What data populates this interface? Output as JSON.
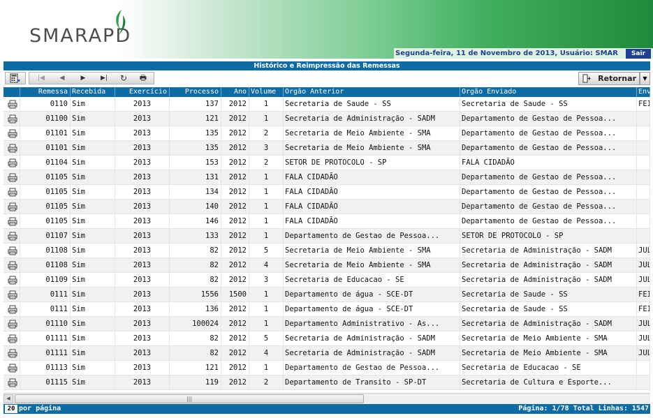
{
  "header": {
    "logo_text": "SMARAPD",
    "date_user": "Segunda-feira, 11 de Novembro de 2013, Usuário: SMAR",
    "logout_label": "Sair"
  },
  "title": "Histórico e Reimpressão das Remessas",
  "toolbar": {
    "nav": [
      "|◀",
      "◀",
      "▶",
      "▶|",
      "↻",
      "🖶"
    ],
    "return_label": "Retornar"
  },
  "columns": [
    "Remessa",
    "Recebida",
    "Exercício",
    "Processo",
    "Ano",
    "Volume",
    "Orgão Anterior",
    "Orgão Enviado",
    "Env"
  ],
  "rows": [
    [
      "0110",
      "Sim",
      "2013",
      "137",
      "2012",
      "1",
      "Secretaria de Saude - SS",
      "Secretaria de Saude - SS",
      "FEI"
    ],
    [
      "01100",
      "Sim",
      "2013",
      "121",
      "2012",
      "1",
      "Secretaria de Administração - SADM",
      "Departamento de Gestao de Pessoa...",
      ""
    ],
    [
      "01101",
      "Sim",
      "2013",
      "135",
      "2012",
      "2",
      "Secretaria de Meio Ambiente - SMA",
      "Departamento de Gestao de Pessoa...",
      ""
    ],
    [
      "01101",
      "Sim",
      "2013",
      "135",
      "2012",
      "3",
      "Secretaria de Meio Ambiente - SMA",
      "Departamento de Gestao de Pessoa...",
      ""
    ],
    [
      "01104",
      "Sim",
      "2013",
      "153",
      "2012",
      "2",
      "SETOR DE PROTOCOLO - SP",
      "FALA CIDADÃO",
      ""
    ],
    [
      "01105",
      "Sim",
      "2013",
      "131",
      "2012",
      "1",
      "FALA CIDADÃO",
      "Departamento de Gestao de Pessoa...",
      ""
    ],
    [
      "01105",
      "Sim",
      "2013",
      "134",
      "2012",
      "1",
      "FALA CIDADÃO",
      "Departamento de Gestao de Pessoa...",
      ""
    ],
    [
      "01105",
      "Sim",
      "2013",
      "140",
      "2012",
      "1",
      "FALA CIDADÃO",
      "Departamento de Gestao de Pessoa...",
      ""
    ],
    [
      "01105",
      "Sim",
      "2013",
      "146",
      "2012",
      "1",
      "FALA CIDADÃO",
      "Departamento de Gestao de Pessoa...",
      ""
    ],
    [
      "01107",
      "Sim",
      "2013",
      "133",
      "2012",
      "1",
      "Departamento de Gestao de Pessoa...",
      "SETOR DE PROTOCOLO - SP",
      ""
    ],
    [
      "01108",
      "Sim",
      "2013",
      "82",
      "2012",
      "5",
      "Secretaria de Meio Ambiente - SMA",
      "Secretaria de Administração - SADM",
      "JUL"
    ],
    [
      "01108",
      "Sim",
      "2013",
      "82",
      "2012",
      "4",
      "Secretaria de Meio Ambiente - SMA",
      "Secretaria de Administração - SADM",
      "JUL"
    ],
    [
      "01109",
      "Sim",
      "2013",
      "82",
      "2012",
      "3",
      "Secretaria de Educacao - SE",
      "Secretaria de Administração - SADM",
      "JUL"
    ],
    [
      "0111",
      "Sim",
      "2013",
      "1556",
      "1500",
      "1",
      "Departamento de água - SCE-DT",
      "Secretaria de Saude - SS",
      "FEI"
    ],
    [
      "0111",
      "Sim",
      "2013",
      "136",
      "2012",
      "1",
      "Departamento de água - SCE-DT",
      "Secretaria de Saude - SS",
      "FEI"
    ],
    [
      "01110",
      "Sim",
      "2013",
      "100024",
      "2012",
      "1",
      "Departamento Administrativo - As...",
      "Secretaria de Administração - SADM",
      "JUL"
    ],
    [
      "01111",
      "Sim",
      "2013",
      "82",
      "2012",
      "5",
      "Secretaria de Administração - SADM",
      "Secretaria de Meio Ambiente - SMA",
      "JUL"
    ],
    [
      "01111",
      "Sim",
      "2013",
      "82",
      "2012",
      "4",
      "Secretaria de Administração - SADM",
      "Secretaria de Meio Ambiente - SMA",
      "JUL"
    ],
    [
      "01113",
      "Sim",
      "2013",
      "121",
      "2012",
      "1",
      "Departamento de Gestao de Pessoa...",
      "Secretaria de Educacao - SE",
      ""
    ],
    [
      "01115",
      "Sim",
      "2013",
      "119",
      "2012",
      "2",
      "Departamento de Transito - SP-DT",
      "Secretaria de Cultura e Esporte...",
      ""
    ]
  ],
  "footer": {
    "per_page_value": "20",
    "per_page_label": "por página",
    "page_info": "Página: 1/78 Total Linhas: 1547"
  }
}
